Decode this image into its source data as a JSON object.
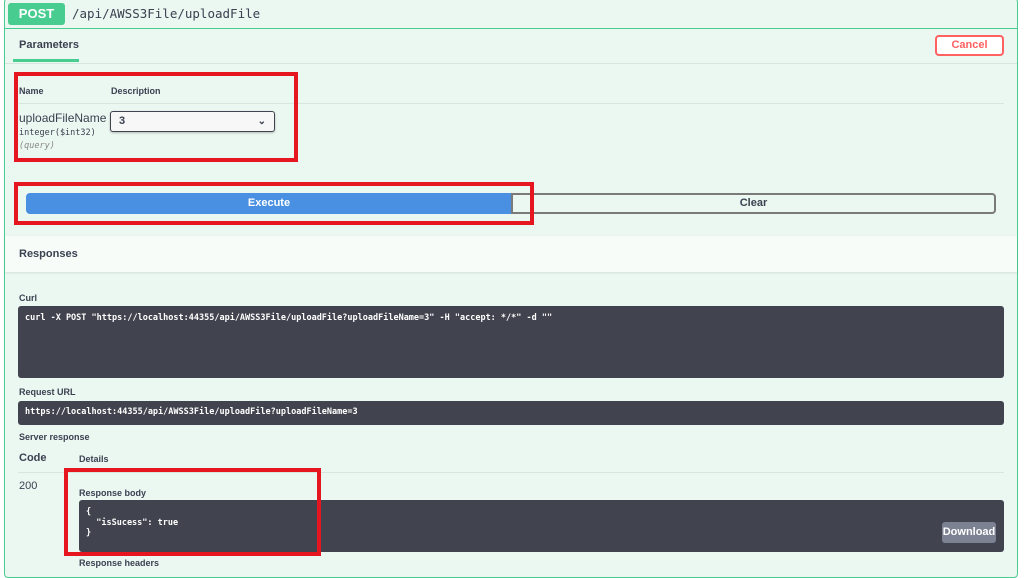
{
  "operation": {
    "method": "POST",
    "path": "/api/AWSS3File/uploadFile"
  },
  "parameters": {
    "tab_label": "Parameters",
    "cancel_label": "Cancel",
    "col_name": "Name",
    "col_description": "Description",
    "param": {
      "name": "uploadFileName",
      "type": "integer($int32)",
      "location": "(query)",
      "value": "3"
    }
  },
  "actions": {
    "execute_label": "Execute",
    "clear_label": "Clear"
  },
  "responses": {
    "title": "Responses",
    "curl_label": "Curl",
    "curl": "curl -X POST \"https://localhost:44355/api/AWSS3File/uploadFile?uploadFileName=3\" -H \"accept: */*\" -d \"\"",
    "request_url_label": "Request URL",
    "request_url": "https://localhost:44355/api/AWSS3File/uploadFile?uploadFileName=3",
    "server_response_label": "Server response",
    "col_code": "Code",
    "col_details": "Details",
    "code": "200",
    "body_label": "Response body",
    "body_lines": [
      "{",
      "  \"isSucess\": true",
      "}"
    ],
    "download_label": "Download",
    "headers_label": "Response headers"
  }
}
